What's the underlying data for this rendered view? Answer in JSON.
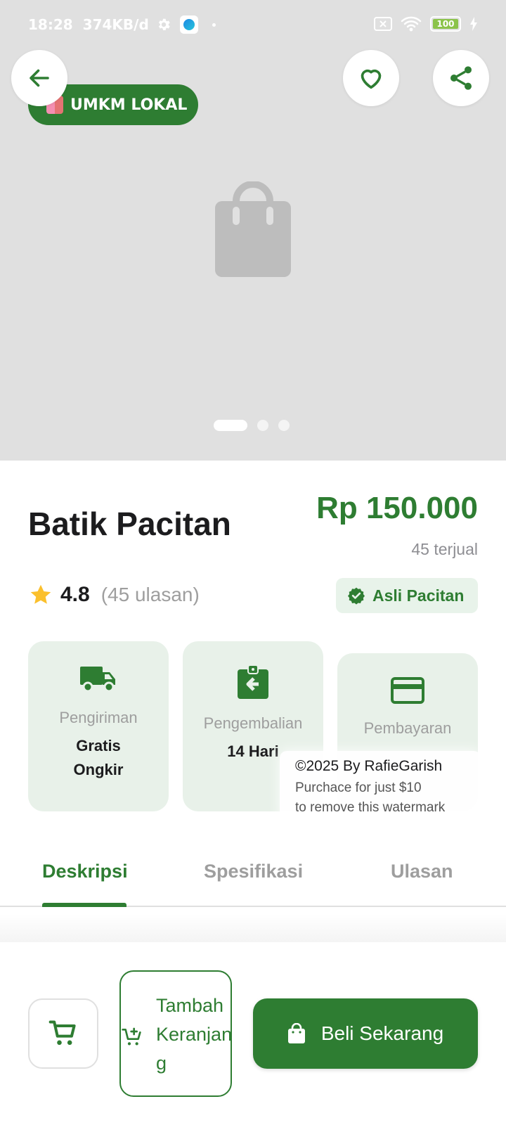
{
  "status_bar": {
    "time": "18:28",
    "network_speed": "374KB/d",
    "battery": "100"
  },
  "hero": {
    "badge_label": "UMKM LOKAL",
    "carousel_slides": 3,
    "carousel_active_index": 0
  },
  "product": {
    "title": "Batik Pacitan",
    "price": "Rp 150.000",
    "sold": "45 terjual",
    "rating": "4.8",
    "reviews": "(45 ulasan)",
    "authenticity_badge": "Asli Pacitan"
  },
  "features": [
    {
      "label": "Pengiriman",
      "value": "Gratis Ongkir",
      "icon": "truck-icon"
    },
    {
      "label": "Pengembalian",
      "value": "14 Hari",
      "icon": "return-icon"
    },
    {
      "label": "Pembayaran",
      "value": "",
      "icon": "credit-card-icon"
    }
  ],
  "watermark": {
    "line1": "©2025 By RafieGarish",
    "line2": "Purchace for just $10",
    "line3": "to remove this watermark"
  },
  "tabs": [
    {
      "label": "Deskripsi",
      "active": true
    },
    {
      "label": "Spesifikasi",
      "active": false
    },
    {
      "label": "Ulasan",
      "active": false
    }
  ],
  "bottom_bar": {
    "add_to_cart_label": "Tambah Keranjang",
    "buy_now_label": "Beli Sekarang"
  },
  "colors": {
    "primary": "#2e7d32",
    "hero_bg": "#e0e0e0",
    "feature_bg": "#e8f1e9",
    "star": "#fbc02d"
  }
}
